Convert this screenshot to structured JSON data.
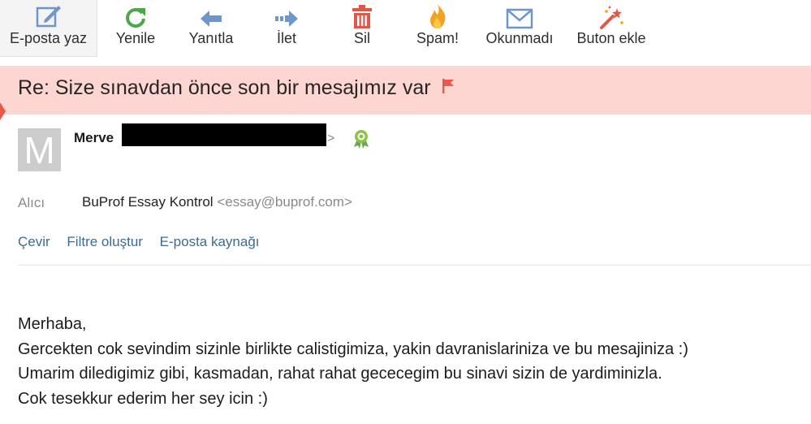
{
  "toolbar": {
    "compose": "E-posta yaz",
    "refresh": "Yenile",
    "reply": "Yanıtla",
    "forward": "İlet",
    "delete": "Sil",
    "spam": "Spam!",
    "unread": "Okunmadı",
    "add_button": "Buton ekle"
  },
  "message": {
    "subject": "Re: Size sınavdan önce son bir mesajımız var",
    "avatar_letter": "M",
    "sender_name": "Merve",
    "sender_suffix": ">",
    "to_label": "Alıcı",
    "to_name": "BuProf Essay Kontrol",
    "to_email": "<essay@buprof.com>",
    "actions": {
      "translate": "Çevir",
      "create_filter": "Filtre oluştur",
      "source": "E-posta kaynağı"
    },
    "body": [
      "Merhaba,",
      "Gercekten cok sevindim sizinle birlikte calistigimiza, yakin davranislariniza ve bu mesajiniza :)",
      "Umarim diledigimiz gibi, kasmadan, rahat rahat gececegim bu sinavi sizin de yardiminizla.",
      "Cok tesekkur ederim her sey icin :)"
    ]
  },
  "colors": {
    "subject_bg": "#fdd6d2",
    "flag": "#e9594b",
    "link": "#3e6b8f",
    "icon_blue": "#6e96c8",
    "icon_green": "#4aa84a",
    "icon_red": "#e2564a",
    "icon_orange": "#f3a21f"
  }
}
